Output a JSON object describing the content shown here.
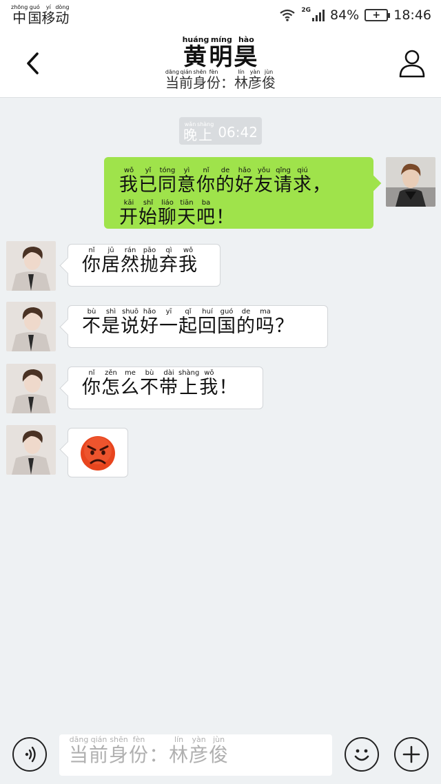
{
  "status_bar": {
    "carrier": "中国移动",
    "carrier_pinyin": [
      "zhōng",
      "guó",
      "yí",
      "dòng"
    ],
    "network": "2G",
    "battery_percent": "84%",
    "time": "18:46"
  },
  "header": {
    "title": "黄明昊",
    "title_pinyin": [
      "huáng",
      "míng",
      "hào"
    ],
    "subtitle": "当前身份：林彦俊",
    "subtitle_pinyin": [
      "dāng",
      "qián",
      "shēn",
      "fèn",
      "",
      "lín",
      "yàn",
      "jùn"
    ]
  },
  "timestamp": {
    "label": "晚上",
    "label_pinyin": [
      "wǎn",
      "shàng"
    ],
    "time": "06:42"
  },
  "messages": [
    {
      "direction": "outgoing",
      "lines": [
        "我已同意你的好友请求，",
        "开始聊天吧！"
      ],
      "pinyin": [
        [
          "wǒ",
          "yǐ",
          "tóng",
          "yì",
          "nǐ",
          "de",
          "hǎo",
          "yǒu",
          "qǐng",
          "qiú",
          ""
        ],
        [
          "kāi",
          "shǐ",
          "liáo",
          "tiān",
          "ba",
          ""
        ]
      ]
    },
    {
      "direction": "incoming",
      "lines": [
        "你居然抛弃我"
      ],
      "pinyin": [
        [
          "nǐ",
          "jū",
          "rán",
          "pāo",
          "qì",
          "wǒ"
        ]
      ]
    },
    {
      "direction": "incoming",
      "lines": [
        "不是说好一起回国的吗？"
      ],
      "pinyin": [
        [
          "bù",
          "shì",
          "shuō",
          "hǎo",
          "yī",
          "qǐ",
          "huí",
          "guó",
          "de",
          "ma",
          ""
        ]
      ]
    },
    {
      "direction": "incoming",
      "lines": [
        "你怎么不带上我！"
      ],
      "pinyin": [
        [
          "nǐ",
          "zěn",
          "me",
          "bù",
          "dài",
          "shàng",
          "wǒ",
          ""
        ]
      ]
    },
    {
      "direction": "incoming",
      "emoji": "angry-face"
    }
  ],
  "input": {
    "placeholder": "当前身份：林彦俊",
    "placeholder_pinyin": [
      "dāng",
      "qián",
      "shēn",
      "fèn",
      "",
      "lín",
      "yàn",
      "jùn"
    ]
  },
  "icons": {
    "back": "chevron-left-icon",
    "profile": "person-icon",
    "voice": "voice-icon",
    "emoji": "smiley-icon",
    "plus": "plus-icon"
  },
  "colors": {
    "outgoing_bubble": "#9fe34b",
    "incoming_bubble": "#ffffff",
    "chat_background": "#eef1f3",
    "emoji_face": "#e8451e"
  }
}
